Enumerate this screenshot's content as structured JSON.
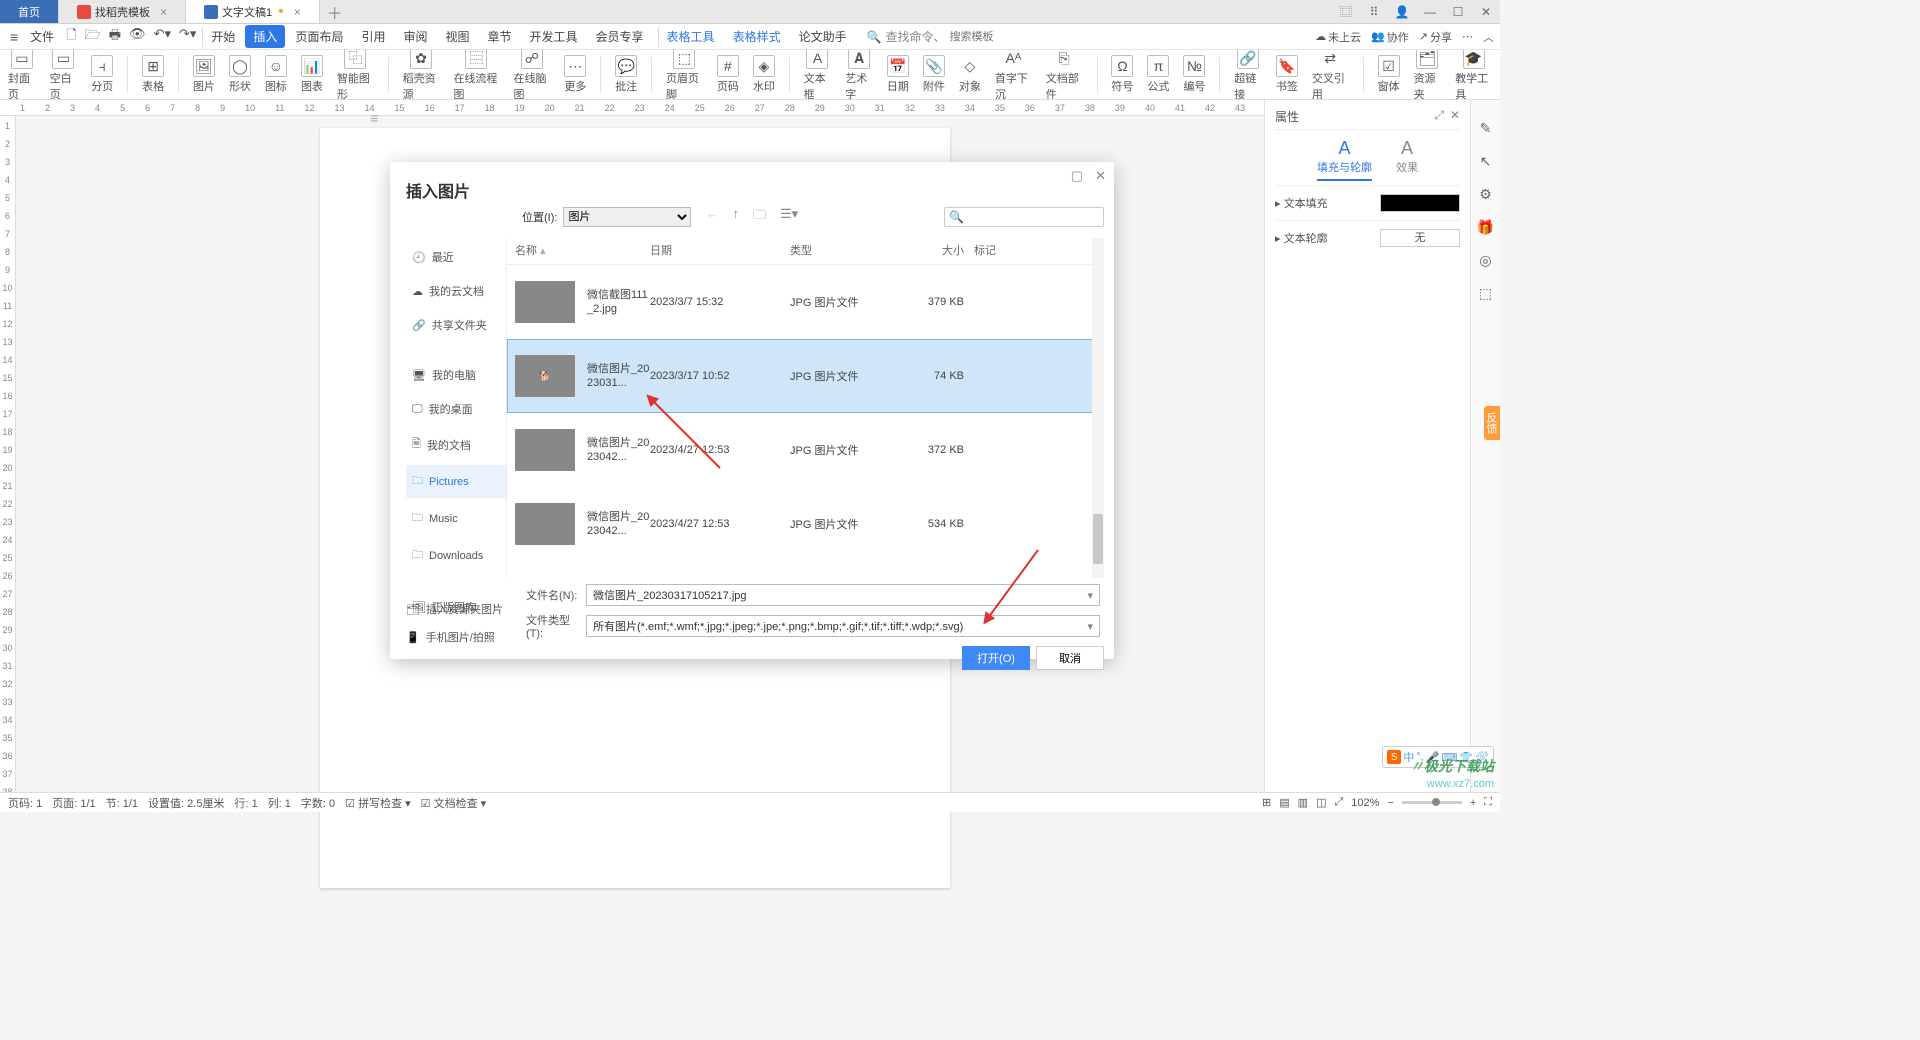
{
  "tabs": {
    "home": "首页",
    "template": "找稻壳模板",
    "doc": "文字文稿1"
  },
  "menubar": {
    "file": "文件",
    "items": [
      "开始",
      "插入",
      "页面布局",
      "引用",
      "审阅",
      "视图",
      "章节",
      "开发工具",
      "会员专享",
      "表格工具",
      "表格样式",
      "论文助手"
    ],
    "search_hint": "查找命令、",
    "search_tmpl": "搜索模板",
    "cloud": "未上云",
    "coop": "协作",
    "share": "分享"
  },
  "ribbon": [
    "封面页",
    "空白页",
    "分页",
    "表格",
    "图片",
    "形状",
    "图标",
    "图表",
    "智能图形",
    "稻壳资源",
    "在线流程图",
    "在线脑图",
    "更多",
    "批注",
    "页眉页脚",
    "页码",
    "水印",
    "文本框",
    "艺术字",
    "日期",
    "附件",
    "对象",
    "首字下沉",
    "文档部件",
    "符号",
    "公式",
    "编号",
    "超链接",
    "书签",
    "交叉引用",
    "窗体",
    "资源夹",
    "教学工具"
  ],
  "rightpanel": {
    "title": "属性",
    "tab1": "填充与轮廓",
    "tab2": "效果",
    "row1": "文本填充",
    "row2": "文本轮廓",
    "row2_val": "无"
  },
  "dialog": {
    "title": "插入图片",
    "location_label": "位置(I):",
    "location_value": "图片",
    "columns": {
      "name": "名称",
      "date": "日期",
      "type": "类型",
      "size": "大小",
      "tag": "标记"
    },
    "side": {
      "recent": "最近",
      "cloud": "我的云文档",
      "shared": "共享文件夹",
      "pc": "我的电脑",
      "desktop": "我的桌面",
      "docs": "我的文档",
      "pictures": "Pictures",
      "music": "Music",
      "downloads": "Downloads",
      "stock": "正版图库",
      "res": "插入资源夹图片",
      "phone": "手机图片/拍照"
    },
    "rows": [
      {
        "name": "微信截图111_2.jpg",
        "date": "2023/3/7 15:32",
        "type": "JPG 图片文件",
        "size": "379 KB"
      },
      {
        "name": "微信图片_2023031...",
        "date": "2023/3/17 10:52",
        "type": "JPG 图片文件",
        "size": "74 KB"
      },
      {
        "name": "微信图片_2023042...",
        "date": "2023/4/27 12:53",
        "type": "JPG 图片文件",
        "size": "372 KB"
      },
      {
        "name": "微信图片_2023042...",
        "date": "2023/4/27 12:53",
        "type": "JPG 图片文件",
        "size": "534 KB"
      }
    ],
    "filename_label": "文件名(N):",
    "filename_value": "微信图片_20230317105217.jpg",
    "filetype_label": "文件类型(T):",
    "filetype_value": "所有图片(*.emf;*.wmf;*.jpg;*.jpeg;*.jpe;*.png;*.bmp;*.gif;*.tif;*.tiff;*.wdp;*.svg)",
    "open": "打开(O)",
    "cancel": "取消"
  },
  "statusbar": {
    "page": "页码: 1",
    "pages": "页面: 1/1",
    "sec": "节: 1/1",
    "setval": "设置值: 2.5厘米",
    "row": "行: 1",
    "col": "列: 1",
    "chars": "字数: 0",
    "spell": "拼写检查",
    "doccheck": "文档检查",
    "zoom": "102%"
  },
  "watermark": {
    "brand": "极光下载站",
    "url": "www.xz7.com"
  },
  "ime": "中"
}
